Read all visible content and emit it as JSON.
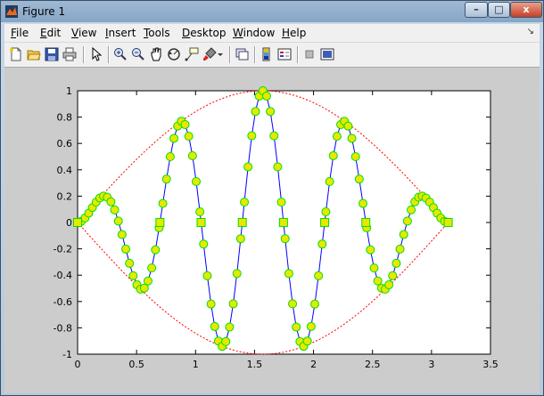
{
  "window": {
    "title": "Figure 1"
  },
  "title_buttons": {
    "minimize": "–",
    "maximize": "□",
    "close": "x"
  },
  "menu": {
    "items": [
      {
        "accel": "F",
        "rest": "ile"
      },
      {
        "accel": "E",
        "rest": "dit"
      },
      {
        "accel": "V",
        "rest": "iew"
      },
      {
        "accel": "I",
        "rest": "nsert"
      },
      {
        "accel": "T",
        "rest": "ools"
      },
      {
        "accel": "D",
        "rest": "esktop"
      },
      {
        "accel": "W",
        "rest": "indow"
      },
      {
        "accel": "H",
        "rest": "elp"
      }
    ],
    "overflow_arrow": "↘"
  },
  "toolbar": {
    "icons": [
      "new-figure-icon",
      "open-file-icon",
      "save-icon",
      "print-icon",
      "edit-plot-icon",
      "zoom-in-icon",
      "zoom-out-icon",
      "pan-icon",
      "rotate-3d-icon",
      "data-cursor-icon",
      "brush-icon",
      "link-plot-icon",
      "colorbar-icon",
      "legend-icon",
      "hide-plot-tools-icon",
      "show-plot-tools-icon"
    ]
  },
  "colors": {
    "curve": "#0000ff",
    "envelope": "#ff0000",
    "marker_fill": "#e8e800",
    "marker_edge": "#00e000"
  },
  "chart_data": {
    "type": "line",
    "xlim": [
      0,
      3.5
    ],
    "ylim": [
      -1,
      1
    ],
    "xticks": [
      "0",
      "0.5",
      "1",
      "1.5",
      "2",
      "2.5",
      "3",
      "3.5"
    ],
    "yticks": [
      "1",
      "0.8",
      "0.6",
      "0.4",
      "0.2",
      "0",
      "-0.2",
      "-0.4",
      "-0.6",
      "-0.8",
      "-1"
    ],
    "grid": false,
    "series": [
      {
        "function": "sin(x)*sin(9x)",
        "x_range": [
          0,
          3.1416
        ],
        "samples": 101,
        "style": "solid",
        "marker": "o"
      },
      {
        "function": "sin(x)",
        "x_range": [
          0,
          3.1416
        ],
        "style": "dashed"
      },
      {
        "function": "-sin(x)",
        "x_range": [
          0,
          3.1416
        ],
        "style": "dashed"
      }
    ],
    "square_markers_x": [
      0,
      0.6981,
      1.0472,
      1.3963,
      1.7453,
      2.0944,
      2.4435,
      3.1416
    ]
  }
}
